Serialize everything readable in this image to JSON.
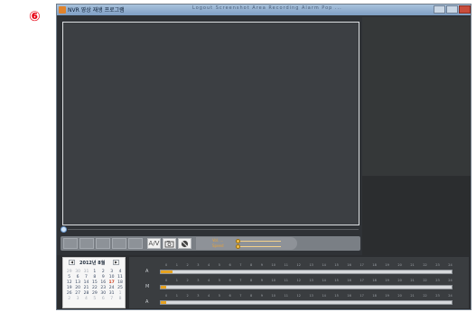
{
  "step_badge": "⑥",
  "window": {
    "title": "NVR 영상 재생 프로그램",
    "menu_text": "Logout   Screenshot Area   Recording   Alarm Pop   ...",
    "minimize_icon": "minimize-icon",
    "maximize_icon": "maximize-icon",
    "close_icon": "close-icon"
  },
  "toolbar": {
    "control_buttons": [
      "prev",
      "play",
      "pause",
      "stop",
      "next"
    ],
    "tool_buttons": [
      {
        "name": "export-button",
        "label": "A/V",
        "icon": "export-icon"
      },
      {
        "name": "snapshot-button",
        "label": "",
        "icon": "camera-icon"
      },
      {
        "name": "block-button",
        "label": "",
        "icon": "no-entry-icon"
      }
    ],
    "volume_label_1": "Vol. ...",
    "volume_label_2": "Speed"
  },
  "calendar": {
    "title": "2012년 8월",
    "prev_icon": "chevron-left-icon",
    "next_icon": "chevron-right-icon",
    "rows": [
      [
        {
          "d": "29",
          "dim": true
        },
        {
          "d": "30",
          "dim": true
        },
        {
          "d": "31",
          "dim": true
        },
        {
          "d": "1"
        },
        {
          "d": "2"
        },
        {
          "d": "3"
        },
        {
          "d": "4"
        }
      ],
      [
        {
          "d": "5"
        },
        {
          "d": "6"
        },
        {
          "d": "7"
        },
        {
          "d": "8"
        },
        {
          "d": "9"
        },
        {
          "d": "10"
        },
        {
          "d": "11"
        }
      ],
      [
        {
          "d": "12"
        },
        {
          "d": "13"
        },
        {
          "d": "14"
        },
        {
          "d": "15"
        },
        {
          "d": "16"
        },
        {
          "d": "17",
          "sel": true
        },
        {
          "d": "18"
        }
      ],
      [
        {
          "d": "19"
        },
        {
          "d": "20"
        },
        {
          "d": "21"
        },
        {
          "d": "22"
        },
        {
          "d": "23"
        },
        {
          "d": "24"
        },
        {
          "d": "25"
        }
      ],
      [
        {
          "d": "26"
        },
        {
          "d": "27"
        },
        {
          "d": "28"
        },
        {
          "d": "29"
        },
        {
          "d": "30"
        },
        {
          "d": "31"
        },
        {
          "d": "1",
          "dim": true
        }
      ],
      [
        {
          "d": "2",
          "dim": true
        },
        {
          "d": "3",
          "dim": true
        },
        {
          "d": "4",
          "dim": true
        },
        {
          "d": "5",
          "dim": true
        },
        {
          "d": "6",
          "dim": true
        },
        {
          "d": "7",
          "dim": true
        },
        {
          "d": "8",
          "dim": true
        }
      ]
    ]
  },
  "timeline": {
    "rows": [
      {
        "label": "A",
        "recorded_fraction": 0.04
      },
      {
        "label": "M",
        "recorded_fraction": 0.02
      },
      {
        "label": "A",
        "recorded_fraction": 0.02
      }
    ],
    "scale": [
      "0",
      "1",
      "2",
      "3",
      "4",
      "5",
      "6",
      "7",
      "8",
      "9",
      "10",
      "11",
      "12",
      "13",
      "14",
      "15",
      "16",
      "17",
      "18",
      "19",
      "20",
      "21",
      "22",
      "23",
      "24"
    ]
  },
  "colors": {
    "badge": "#e60012",
    "recorded": "#e7a21f",
    "window_bg": "#2f3236"
  }
}
